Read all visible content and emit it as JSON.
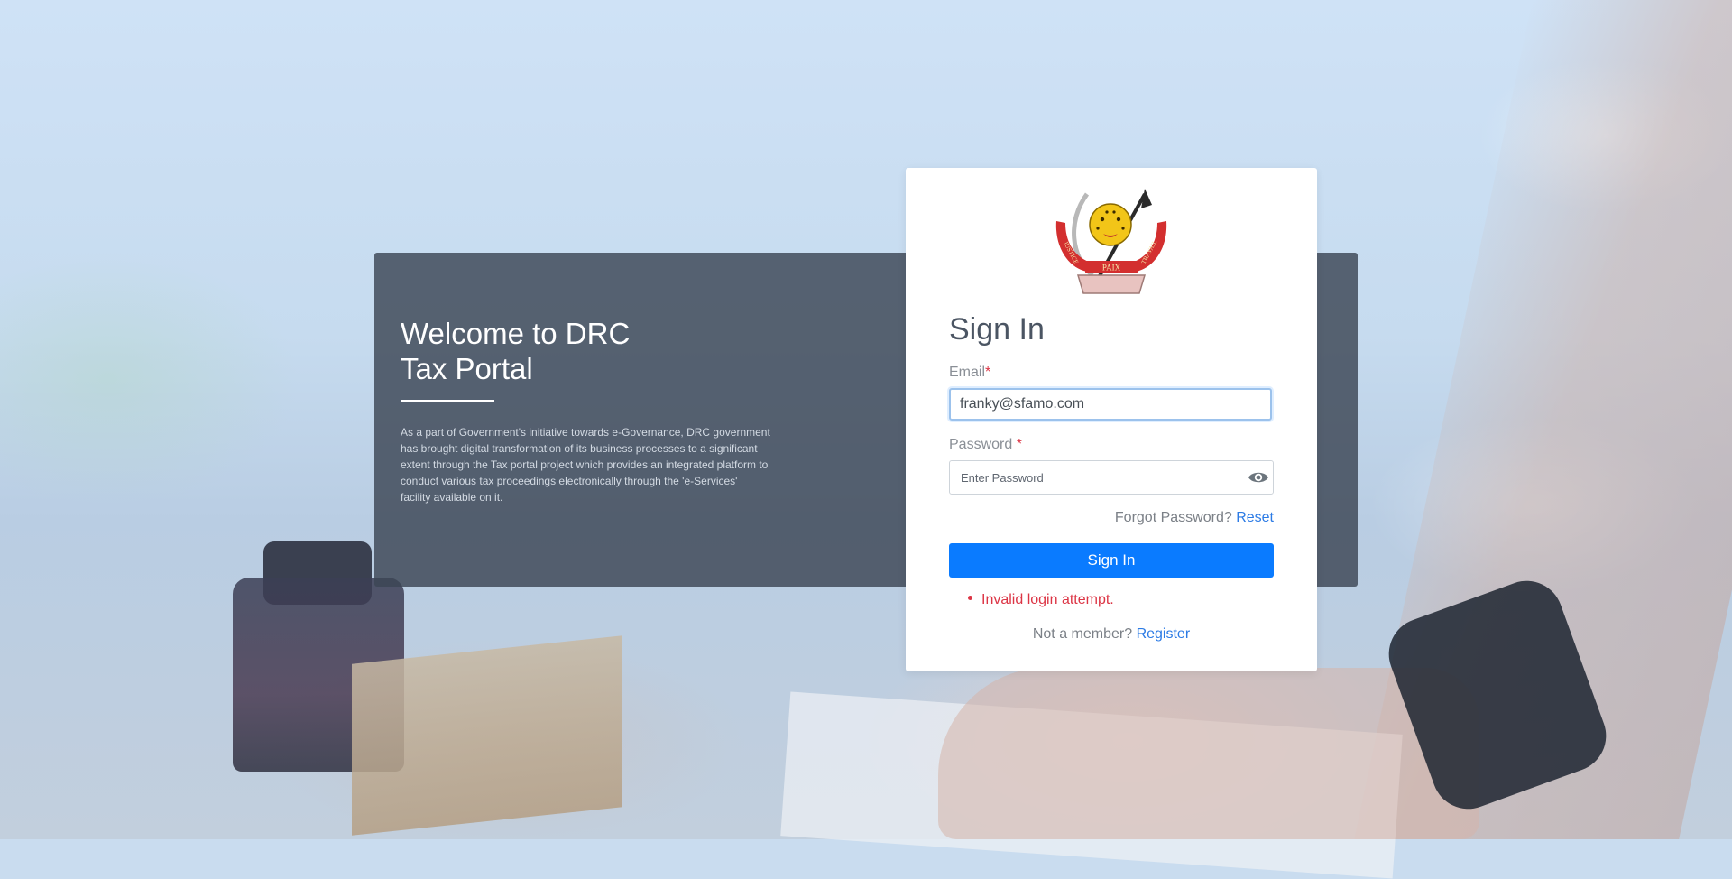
{
  "welcome": {
    "title_line1": "Welcome to DRC",
    "title_line2": "Tax Portal",
    "description": "As a part of Government's initiative towards e-Governance, DRC government has brought digital transformation of its business processes to a significant extent through the Tax portal project which provides an integrated platform to conduct various tax proceedings electronically through the 'e-Services' facility available on it."
  },
  "form": {
    "title": "Sign In",
    "email_label": "Email",
    "required_mark": "*",
    "email_value": "franky@sfamo.com",
    "password_label": "Password",
    "password_placeholder": "Enter Password",
    "forgot_text": "Forgot Password?",
    "reset_link": "Reset",
    "submit_label": "Sign In",
    "error_message": "Invalid login attempt.",
    "member_text": "Not a member?",
    "register_link": "Register"
  },
  "logo": {
    "banner_left": "JUSTICE",
    "banner_center": "PAIX",
    "banner_right": "TRAVAIL"
  },
  "colors": {
    "primary": "#0a7bff",
    "link": "#2c7be5",
    "error": "#dc3545",
    "panel": "#3c4654"
  },
  "icons": {
    "password_toggle": "eye-icon",
    "logo": "coat-of-arms-logo"
  }
}
